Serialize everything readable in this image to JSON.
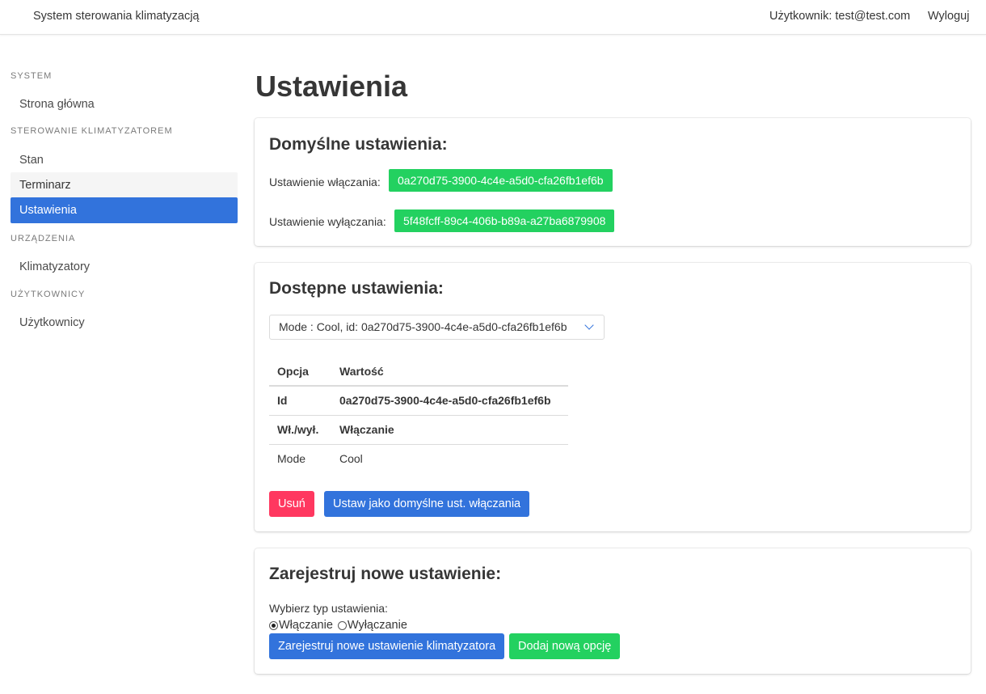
{
  "navbar": {
    "brand": "System sterowania klimatyzacją",
    "user": "Użytkownik: test@test.com",
    "logout": "Wyloguj"
  },
  "sidebar": {
    "sections": [
      {
        "label": "System",
        "items": [
          "Strona główna"
        ]
      },
      {
        "label": "Sterowanie klimatyzatorem",
        "items": [
          "Stan",
          "Terminarz",
          "Ustawienia"
        ]
      },
      {
        "label": "Urządzenia",
        "items": [
          "Klimatyzatory"
        ]
      },
      {
        "label": "Użytkownicy",
        "items": [
          "Użytkownicy"
        ]
      }
    ],
    "active_item": "Ustawienia",
    "hovered_item": "Terminarz"
  },
  "page_title": "Ustawienia",
  "defaults_card": {
    "title": "Domyślne ustawienia:",
    "on_label": "Ustawienie włączania:",
    "on_value": "0a270d75-3900-4c4e-a5d0-cfa26fb1ef6b",
    "off_label": "Ustawienie wyłączania:",
    "off_value": "5f48fcff-89c4-406b-b89a-a27ba6879908"
  },
  "available_card": {
    "title": "Dostępne ustawienia:",
    "select_value": "Mode : Cool, id: 0a270d75-3900-4c4e-a5d0-cfa26fb1ef6b",
    "table": {
      "headers": [
        "Opcja",
        "Wartość"
      ],
      "rows": [
        [
          "Id",
          "0a270d75-3900-4c4e-a5d0-cfa26fb1ef6b"
        ],
        [
          "Wł./wył.",
          "Włączanie"
        ],
        [
          "Mode",
          "Cool"
        ]
      ]
    },
    "delete_button": "Usuń",
    "set_default_button": "Ustaw jako domyślne ust. włączania"
  },
  "register_card": {
    "title": "Zarejestruj nowe ustawienie:",
    "type_label": "Wybierz typ ustawienia:",
    "radio_on": "Włączanie",
    "radio_off": "Wyłączanie",
    "selected_type": "Włączanie",
    "register_button": "Zarejestruj nowe ustawienie klimatyzatora",
    "add_option_button": "Dodaj nową opcję"
  },
  "colors": {
    "primary": "#3273dc",
    "success": "#23d160",
    "danger": "#ff3860"
  }
}
